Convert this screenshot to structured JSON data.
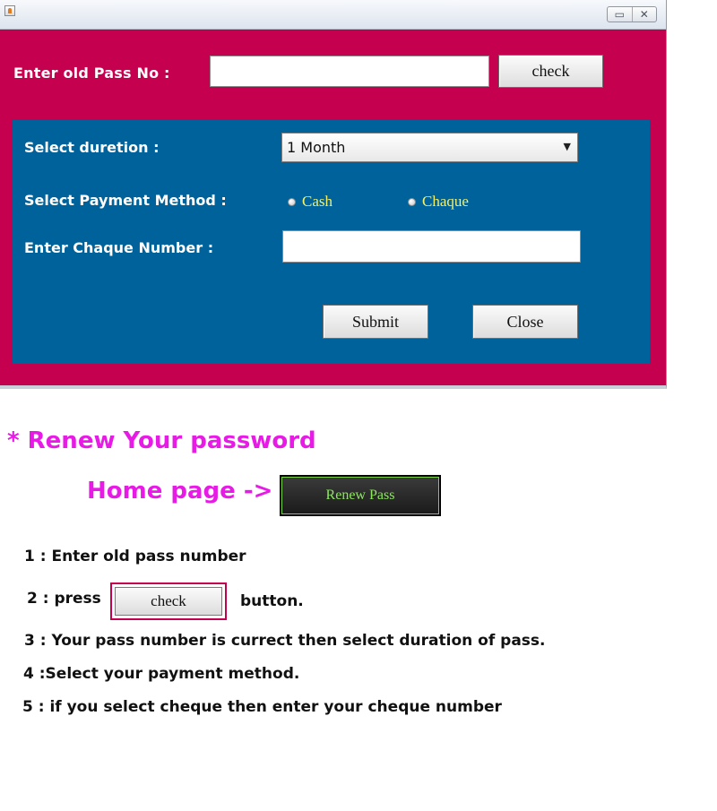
{
  "window": {
    "controls": {
      "minimize": "▭",
      "close": "✕"
    },
    "old_pass": {
      "label": "Enter old Pass No :",
      "value": "",
      "check_label": "check"
    },
    "panel": {
      "duration_label": "Select duretion :",
      "duration_value": "1 Month",
      "payment_label": "Select Payment Method :",
      "payment_options": [
        "Cash",
        "Chaque"
      ],
      "cheque_label": "Enter Chaque Number :",
      "cheque_value": "",
      "submit_label": "Submit",
      "close_label": "Close"
    }
  },
  "instructions": {
    "heading": "* Renew Your password",
    "home_label": "Home page ->",
    "renew_button": "Renew Pass",
    "step1": "1 : Enter old pass number",
    "step2_prefix": "2 : press",
    "step2_button": "check",
    "step2_suffix": "button.",
    "step3": "3 : Your pass number is currect then select duration of pass.",
    "step4": "4 :Select your payment method.",
    "step5": "5 : if you select cheque then enter your cheque number"
  },
  "colors": {
    "window_bg": "#c4004f",
    "panel_bg": "#00629a",
    "heading": "#e81be6",
    "radio_text": "#f3f06a",
    "renew_text": "#8be85c"
  }
}
